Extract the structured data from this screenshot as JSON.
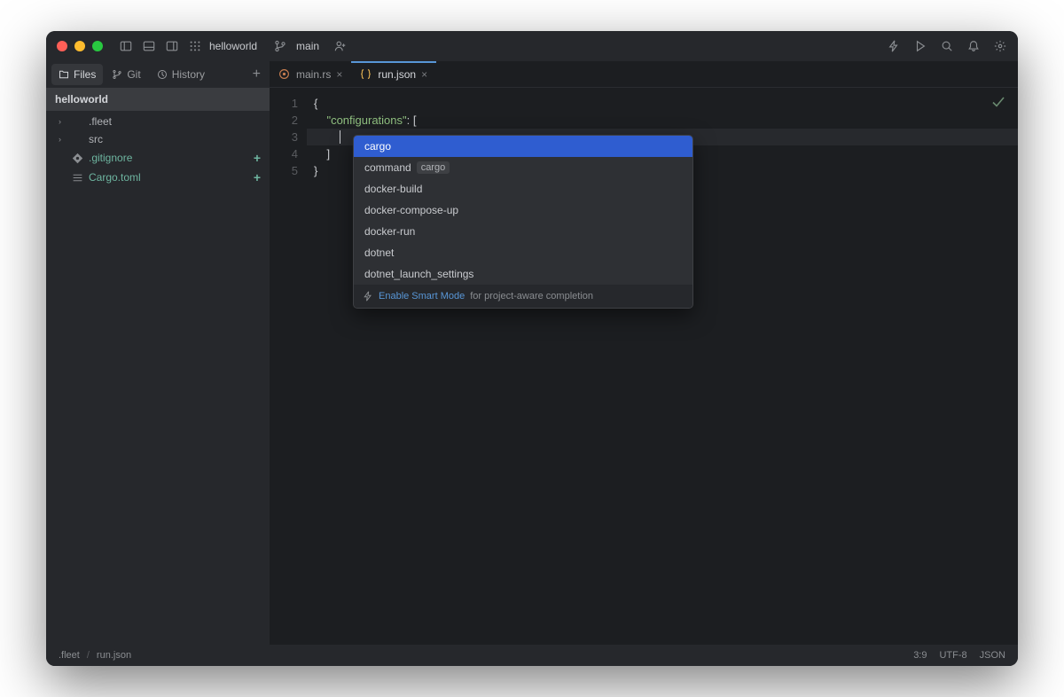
{
  "titlebar": {
    "project": "helloworld",
    "branch": "main"
  },
  "side_tabs": {
    "files": "Files",
    "git": "Git",
    "history": "History"
  },
  "project_name": "helloworld",
  "tree": [
    {
      "name": ".fleet",
      "type": "folder"
    },
    {
      "name": "src",
      "type": "folder"
    },
    {
      "name": ".gitignore",
      "type": "file",
      "modified": true
    },
    {
      "name": "Cargo.toml",
      "type": "file",
      "modified": true
    }
  ],
  "editor_tabs": [
    {
      "name": "main.rs",
      "icon": "rust",
      "active": false
    },
    {
      "name": "run.json",
      "icon": "json",
      "active": true
    }
  ],
  "code_lines": [
    {
      "n": "1",
      "text": "{"
    },
    {
      "n": "2",
      "text": "    ",
      "str": "\"configurations\"",
      "post": ": ["
    },
    {
      "n": "3",
      "text": "        ",
      "current": true
    },
    {
      "n": "4",
      "text": "    ]"
    },
    {
      "n": "5",
      "text": "}"
    }
  ],
  "completion": {
    "items": [
      {
        "label": "cargo",
        "selected": true
      },
      {
        "label": "command",
        "hint": "cargo"
      },
      {
        "label": "docker-build"
      },
      {
        "label": "docker-compose-up"
      },
      {
        "label": "docker-run"
      },
      {
        "label": "dotnet"
      },
      {
        "label": "dotnet_launch_settings"
      }
    ],
    "footer_link": "Enable Smart Mode",
    "footer_text": "for project-aware completion"
  },
  "status": {
    "path1": ".fleet",
    "path2": "run.json",
    "pos": "3:9",
    "encoding": "UTF-8",
    "lang": "JSON"
  }
}
